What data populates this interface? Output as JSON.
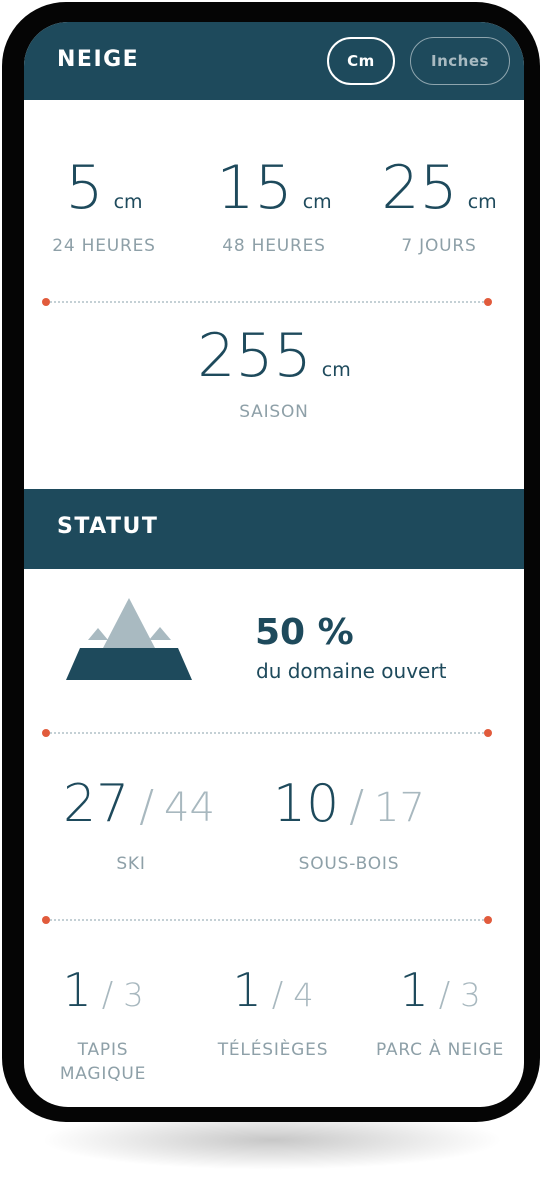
{
  "snow_header": {
    "title": "NEIGE",
    "unit_options": [
      "Cm",
      "Inches"
    ],
    "selected_unit": "Cm"
  },
  "snowfall": [
    {
      "value": "5",
      "unit": "cm",
      "label": "24 HEURES"
    },
    {
      "value": "15",
      "unit": "cm",
      "label": "48 HEURES"
    },
    {
      "value": "25",
      "unit": "cm",
      "label": "7 JOURS"
    }
  ],
  "season": {
    "value": "255",
    "unit": "cm",
    "label": "SAISON"
  },
  "status_header": {
    "title": "STATUT"
  },
  "domain": {
    "percent": "50 %",
    "caption": "du domaine ouvert"
  },
  "trails": [
    {
      "open": "27",
      "separator": "/",
      "total": "44",
      "label": "SKI"
    },
    {
      "open": "10",
      "separator": "/",
      "total": "17",
      "label": "SOUS-BOIS"
    }
  ],
  "lifts": [
    {
      "open": "1",
      "separator": "/",
      "total": "3",
      "label_line1": "TAPIS",
      "label_line2": "MAGIQUE"
    },
    {
      "open": "1",
      "separator": "/",
      "total": "4",
      "label_line1": "TÉLÉSIÈGES",
      "label_line2": ""
    },
    {
      "open": "1",
      "separator": "/",
      "total": "3",
      "label_line1": "PARC À NEIGE",
      "label_line2": ""
    }
  ],
  "colors": {
    "primary": "#1e4a5c",
    "accent": "#e15b3c",
    "muted": "#8ea0a8"
  }
}
